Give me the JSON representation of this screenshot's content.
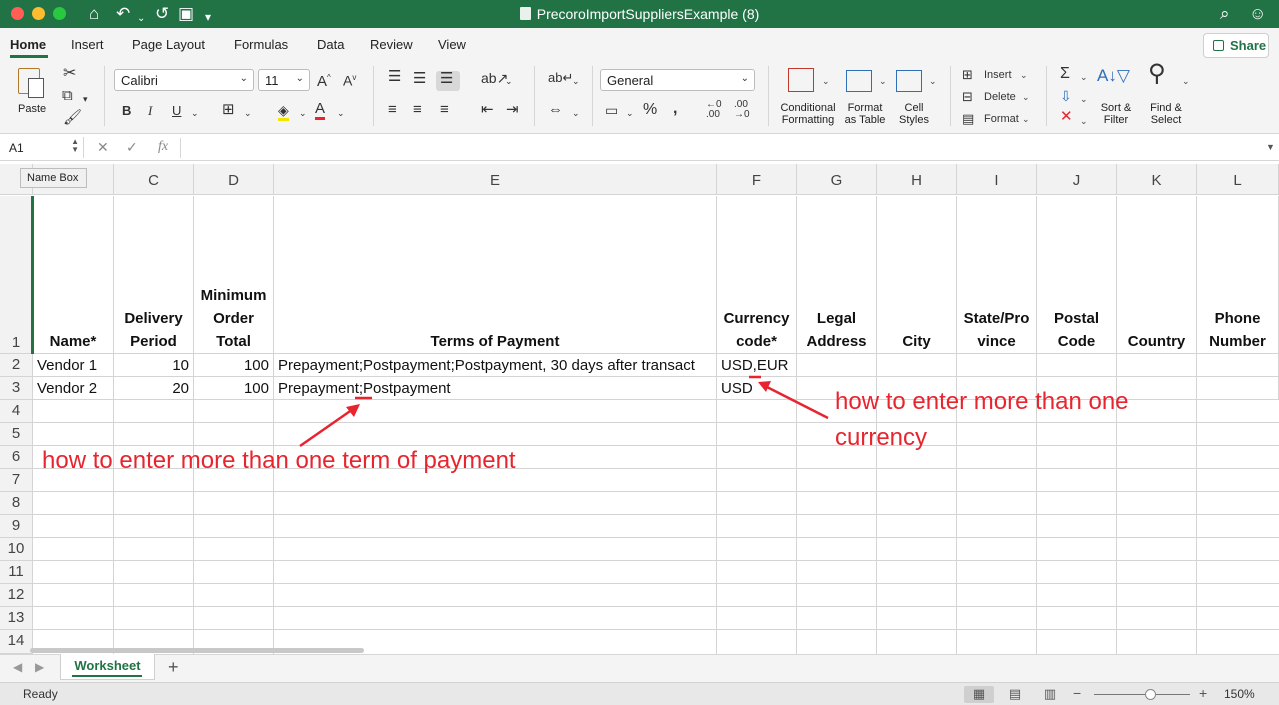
{
  "window": {
    "title": "PrecoroImportSuppliersExample (8)"
  },
  "ribbon_tabs": [
    "Home",
    "Insert",
    "Page Layout",
    "Formulas",
    "Data",
    "Review",
    "View"
  ],
  "share_label": "Share",
  "ribbon": {
    "paste_label": "Paste",
    "font_name": "Calibri",
    "font_size": "11",
    "number_format": "General",
    "conditional_formatting": "Conditional\nFormatting",
    "format_as_table": "Format\nas Table",
    "cell_styles": "Cell\nStyles",
    "insert_label": "Insert",
    "delete_label": "Delete",
    "format_label": "Format",
    "sort_filter": "Sort &\nFilter",
    "find_select": "Find &\nSelect",
    "bold": "B",
    "italic": "I",
    "underline": "U"
  },
  "formula_bar": {
    "name_box": "A1",
    "fx": "fx",
    "tooltip": "Name Box"
  },
  "columns": [
    "C",
    "D",
    "E",
    "F",
    "G",
    "H",
    "I",
    "J",
    "K",
    "L"
  ],
  "rows": [
    "1",
    "2",
    "3",
    "4",
    "5",
    "6",
    "7",
    "8",
    "9",
    "10",
    "11",
    "12",
    "13",
    "14"
  ],
  "headers": {
    "name": "Name*",
    "delivery": "Delivery\nPeriod",
    "min_order": "Minimum\nOrder\nTotal",
    "terms": "Terms of Payment",
    "currency": "Currency\ncode*",
    "legal": "Legal\nAddress",
    "city": "City",
    "state": "State/Pro\nvince",
    "postal": "Postal\nCode",
    "country": "Country",
    "phone": "Phone\nNumber"
  },
  "data_rows": [
    {
      "name": "Vendor 1",
      "delivery": "10",
      "min_order": "100",
      "terms": "Prepayment;Postpayment;Postpayment, 30 days after transact",
      "currency": "USD,EUR"
    },
    {
      "name": "Vendor 2",
      "delivery": "20",
      "min_order": "100",
      "terms": "Prepayment;Postpayment",
      "currency": "USD"
    }
  ],
  "annotations": {
    "currency_note_line1": "how to enter more than one",
    "currency_note_line2": "currency",
    "terms_note": "how to enter more than one term of payment",
    "color": "#e8242e"
  },
  "sheet_tabs": [
    "Worksheet"
  ],
  "status": {
    "ready": "Ready",
    "zoom": "150%"
  },
  "colors": {
    "accent": "#217346"
  }
}
